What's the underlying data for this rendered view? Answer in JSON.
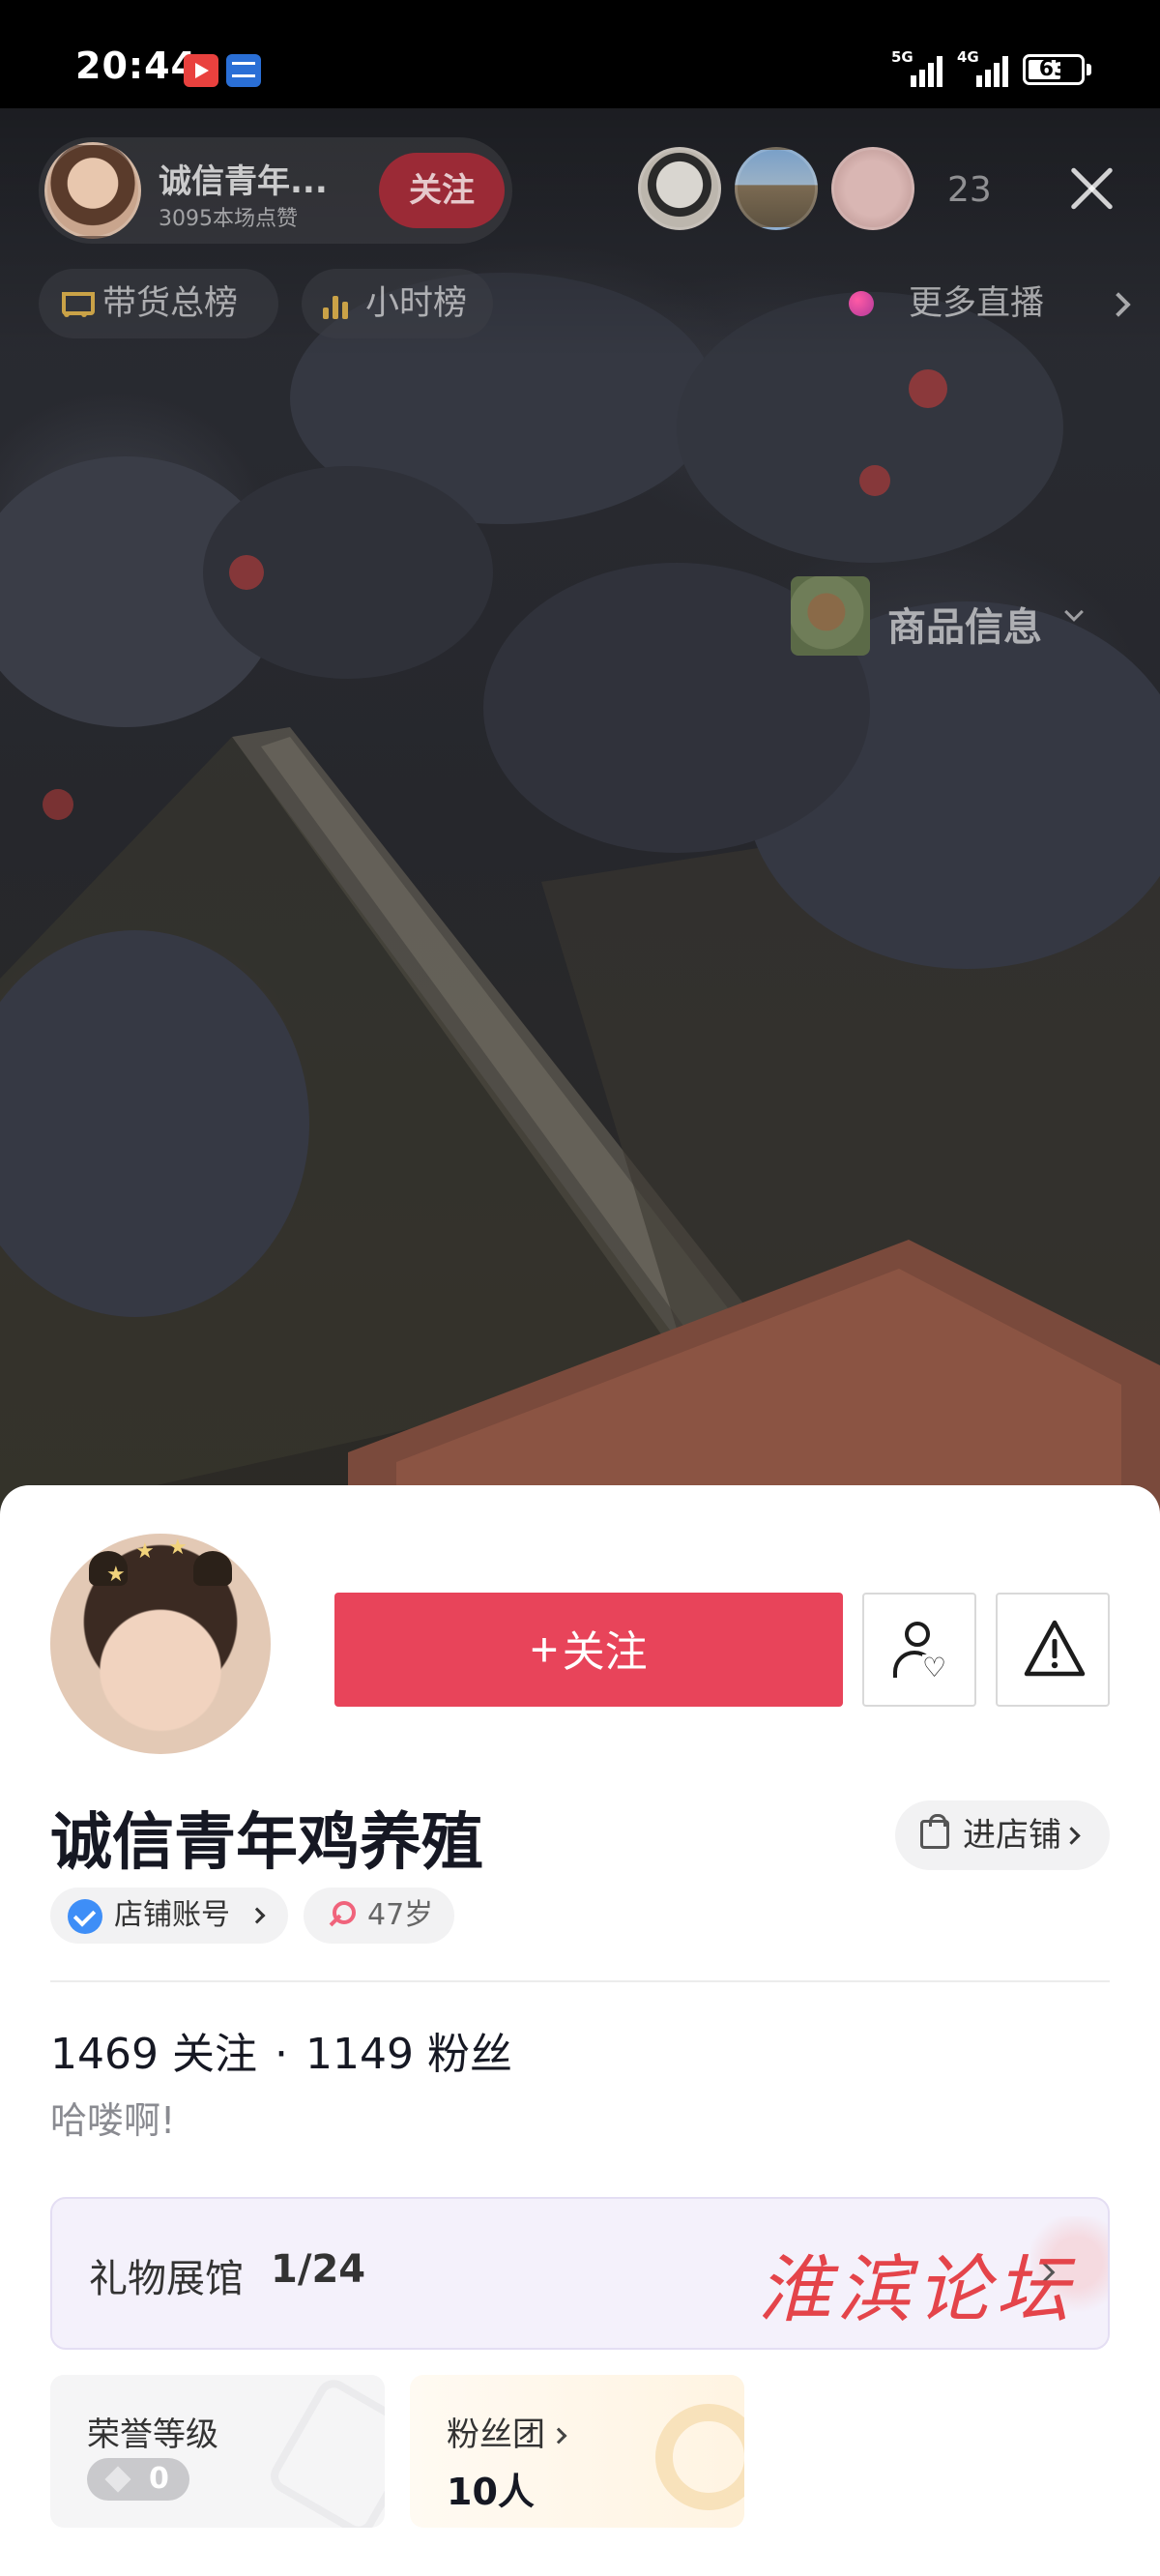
{
  "status_bar": {
    "time": "20:44",
    "network_1": "5G",
    "network_2": "4G",
    "battery": "63",
    "battery_level": 0.63
  },
  "live": {
    "host_name": "诚信青年...",
    "host_likes": "3095本场点赞",
    "follow_label": "关注",
    "viewer_count": "23",
    "rank_label": "带货总榜",
    "hour_rank_label": "小时榜",
    "more_live_label": "更多直播",
    "product_info_label": "商品信息",
    "icons": [
      "cart-icon",
      "bar-chart-icon",
      "close-icon",
      "chevron-down-icon",
      "chevron-right-icon"
    ]
  },
  "profile": {
    "follow_button": "关注",
    "name": "诚信青年鸡养殖",
    "shop_button": "进店铺",
    "tags": {
      "shop_account": "店铺账号",
      "age": "47岁"
    },
    "following_count": "1469",
    "following_label": "关注",
    "separator": "·",
    "followers_count": "1149",
    "followers_label": "粉丝",
    "bio": "哈喽啊!",
    "gift_hall": {
      "label": "礼物展馆",
      "count": "1/24"
    },
    "honor_level": {
      "title": "荣誉等级",
      "value": "0"
    },
    "fan_club": {
      "title": "粉丝团",
      "value": "10人"
    }
  },
  "watermark": "淮滨论坛",
  "colors": {
    "primary_red": "#e8445a",
    "verified_blue": "#3e8ef7",
    "female_pink": "#f0637b",
    "watermark_red": "#e4444a"
  }
}
